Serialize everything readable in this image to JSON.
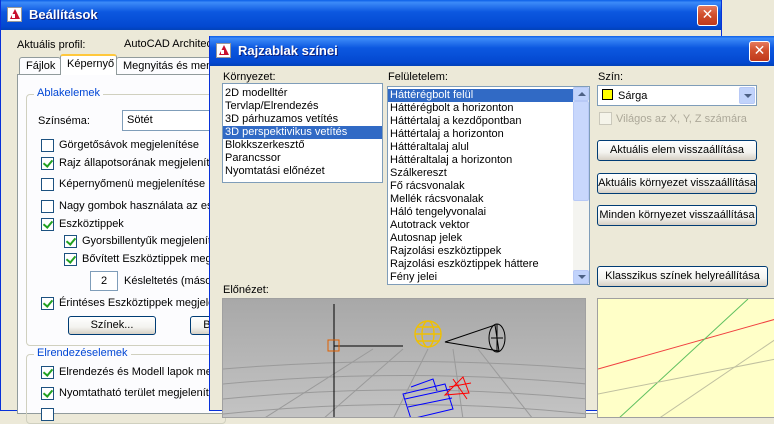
{
  "back_window": {
    "title": "Beállítások",
    "profile_label": "Aktuális profil:",
    "profile_value": "AutoCAD Architec",
    "tabs": [
      {
        "label": "Fájlok"
      },
      {
        "label": "Képernyő"
      },
      {
        "label": "Megnyitás és ment"
      }
    ],
    "group_window_elements": {
      "title": "Ablakelemek",
      "scheme_label": "Színséma:",
      "scheme_value": "Sötét",
      "options": [
        {
          "label": "Görgetősávok megjelenítése",
          "checked": false
        },
        {
          "label": "Rajz állapotsorának megjelenítése",
          "checked": true
        },
        {
          "label": "Képernyőmenü megjelenítése",
          "checked": false
        },
        {
          "label": "Nagy gombok használata az esz",
          "checked": false
        },
        {
          "label": "Eszköztippek",
          "checked": true
        },
        {
          "label": "Gyorsbillentyűk megjelenítése",
          "checked": true
        },
        {
          "label": "Bővített Eszköztippek megjel",
          "checked": true
        }
      ],
      "delay_value": "2",
      "delay_label": "Késleltetés (másod",
      "rollover_label": "Érintéses Eszköztippek megjele",
      "rollover_checked": true,
      "colors_button": "Színek...",
      "fonts_button": "Be"
    },
    "group_layout_elements": {
      "title": "Elrendezéselemek",
      "options": [
        {
          "label": "Elrendezés és Modell lapok meg",
          "checked": true
        },
        {
          "label": "Nyomtatható terület megjeleníté",
          "checked": true
        }
      ]
    }
  },
  "dialog": {
    "title": "Rajzablak színei",
    "context_label": "Környezet:",
    "contexts": [
      {
        "label": "2D modelltér",
        "selected": false
      },
      {
        "label": "Tervlap/Elrendezés",
        "selected": false
      },
      {
        "label": "3D párhuzamos vetítés",
        "selected": false
      },
      {
        "label": "3D perspektivikus vetítés",
        "selected": true
      },
      {
        "label": "Blokkszerkesztő",
        "selected": false
      },
      {
        "label": "Parancssor",
        "selected": false
      },
      {
        "label": "Nyomtatási előnézet",
        "selected": false
      }
    ],
    "interface_label": "Felületelem:",
    "interface_elements": [
      {
        "label": "Háttérégbolt felül",
        "selected": true
      },
      {
        "label": "Háttérégbolt a horizonton",
        "selected": false
      },
      {
        "label": "Háttértalaj a kezdőpontban",
        "selected": false
      },
      {
        "label": "Háttértalaj a horizonton",
        "selected": false
      },
      {
        "label": "Háttéraltalaj alul",
        "selected": false
      },
      {
        "label": "Háttéraltalaj a horizonton",
        "selected": false
      },
      {
        "label": "Szálkereszt",
        "selected": false
      },
      {
        "label": "Fő rácsvonalak",
        "selected": false
      },
      {
        "label": "Mellék rácsvonalak",
        "selected": false
      },
      {
        "label": "Háló tengelyvonalai",
        "selected": false
      },
      {
        "label": "Autotrack vektor",
        "selected": false
      },
      {
        "label": "Autosnap jelek",
        "selected": false
      },
      {
        "label": "Rajzolási eszköztippek",
        "selected": false
      },
      {
        "label": "Rajzolási eszköztippek háttere",
        "selected": false
      },
      {
        "label": "Fény jelei",
        "selected": false
      }
    ],
    "color_label": "Szín:",
    "color_value": "Sárga",
    "color_swatch": "#FFFF00",
    "xyz_label": "Világos az X, Y, Z számára",
    "xyz_checked": false,
    "restore_element_button": "Aktuális elem visszaállítása",
    "restore_context_button": "Aktuális környezet visszaállítása",
    "restore_all_button": "Minden környezet visszaállítása",
    "classic_colors_button": "Klasszikus színek helyreállítása",
    "preview_label": "Előnézet:",
    "preview_background": "#B4B4B4",
    "swatch_preview_background": "#FFFFC8"
  }
}
